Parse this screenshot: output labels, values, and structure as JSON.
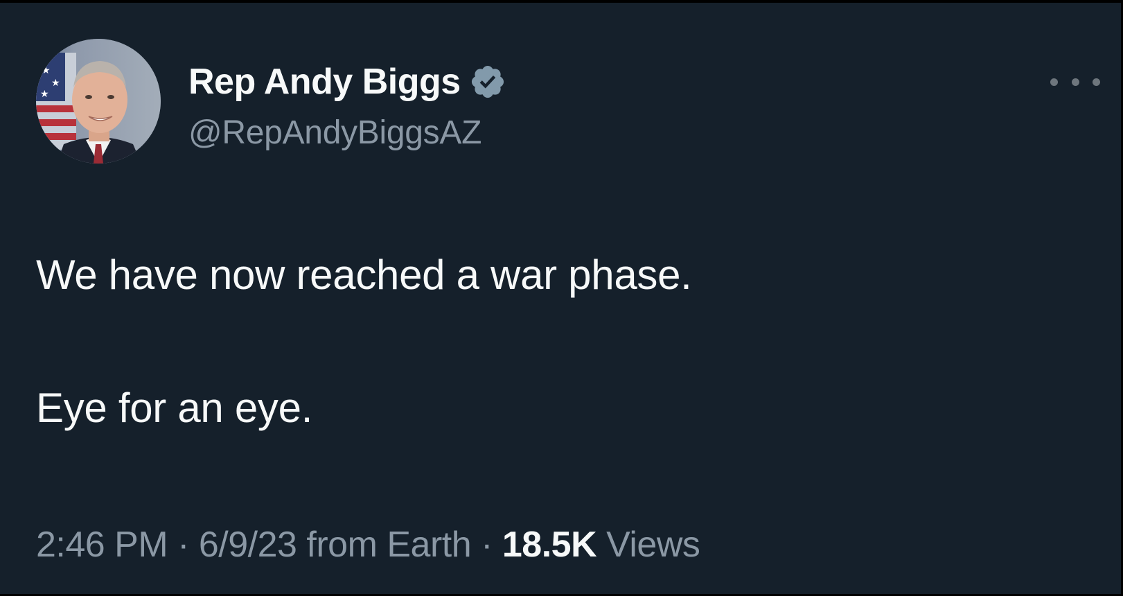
{
  "author": {
    "display_name": "Rep Andy Biggs",
    "handle": "@RepAndyBiggsAZ",
    "verified_icon": "verified-badge-icon",
    "verified_color": "#829aab"
  },
  "tweet": {
    "lines": [
      "We have now reached a war phase.",
      "Eye for an eye."
    ]
  },
  "meta": {
    "time": "2:46 PM",
    "separator": "·",
    "date_source": "6/9/23 from Earth",
    "views_count": "18.5K",
    "views_label": "Views"
  },
  "colors": {
    "background": "#15202b",
    "text_primary": "#f7f9f9",
    "text_secondary": "#8b98a5"
  },
  "icons": {
    "more": "more-horizontal-icon"
  }
}
